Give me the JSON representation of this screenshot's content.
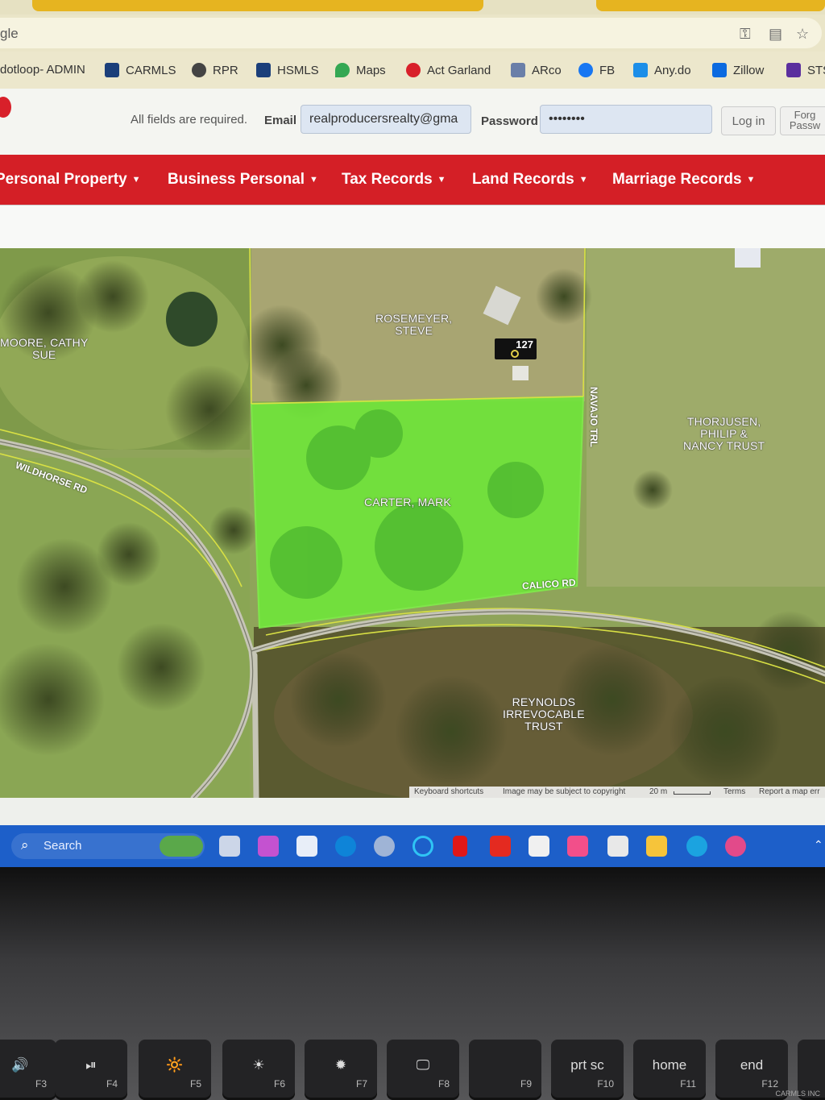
{
  "browser": {
    "url_fragment": "gle",
    "icons": [
      "key-icon",
      "reader-icon",
      "star-icon"
    ]
  },
  "bookmarks": [
    {
      "label": "dotloop- ADMIN",
      "icon": "dotloop-icon"
    },
    {
      "label": "CARMLS",
      "icon": "carmls-icon"
    },
    {
      "label": "RPR",
      "icon": "rpr-icon"
    },
    {
      "label": "HSMLS",
      "icon": "hsmls-icon"
    },
    {
      "label": "Maps",
      "icon": "maps-pin-icon"
    },
    {
      "label": "Act Garland",
      "icon": "act-icon"
    },
    {
      "label": "ARco",
      "icon": "arco-icon"
    },
    {
      "label": "FB",
      "icon": "facebook-icon"
    },
    {
      "label": "Any.do",
      "icon": "anydo-icon"
    },
    {
      "label": "Zillow",
      "icon": "zillow-icon"
    },
    {
      "label": "STS",
      "icon": "sts-icon"
    }
  ],
  "login": {
    "required_note": "All fields are required.",
    "email_label": "Email",
    "email_value": "realproducersrealty@gma",
    "password_label": "Password",
    "password_value": "••••••••",
    "login_button": "Log in",
    "forgot_line1": "Forg",
    "forgot_line2": "Passw"
  },
  "nav": {
    "items": [
      "Personal Property",
      "Business Personal",
      "Tax Records",
      "Land Records",
      "Marriage Records"
    ]
  },
  "map": {
    "owners": {
      "moore": [
        "MOORE, CATHY",
        "SUE"
      ],
      "rosemeyer": [
        "ROSEMEYER,",
        "STEVE"
      ],
      "thorjusen": [
        "THORJUSEN,",
        "PHILIP &",
        "NANCY TRUST"
      ],
      "carter": [
        "CARTER, MARK"
      ],
      "reynolds": [
        "REYNOLDS",
        "IRREVOCABLE",
        "TRUST"
      ]
    },
    "roads": {
      "wildhorse": "WILDHORSE RD",
      "navajo": "NAVAJO TRL",
      "calico": "CALICO RD"
    },
    "address_number": "127",
    "attribution": {
      "shortcuts": "Keyboard shortcuts",
      "copyright": "Image may be subject to copyright",
      "scale": "20 m",
      "terms": "Terms",
      "report": "Report a map err"
    },
    "colors": {
      "parcel_highlight": "#6fe83a",
      "parcel_border": "#c8e63c"
    }
  },
  "taskbar": {
    "search_label": "Search"
  },
  "keyboard": {
    "keys": [
      {
        "main": "🔊",
        "fn": "F3"
      },
      {
        "main": "⏯",
        "fn": "F4"
      },
      {
        "main": "🔆",
        "fn": "F5"
      },
      {
        "main": "☀",
        "fn": "F6"
      },
      {
        "main": "✹",
        "fn": "F7"
      },
      {
        "main": "🖵",
        "fn": "F8"
      },
      {
        "main": "",
        "fn": "F9"
      },
      {
        "main": "prt sc",
        "fn": "F10"
      },
      {
        "main": "home",
        "fn": "F11"
      },
      {
        "main": "end",
        "fn": "F12"
      }
    ]
  },
  "watermark": "CARMLS INC"
}
